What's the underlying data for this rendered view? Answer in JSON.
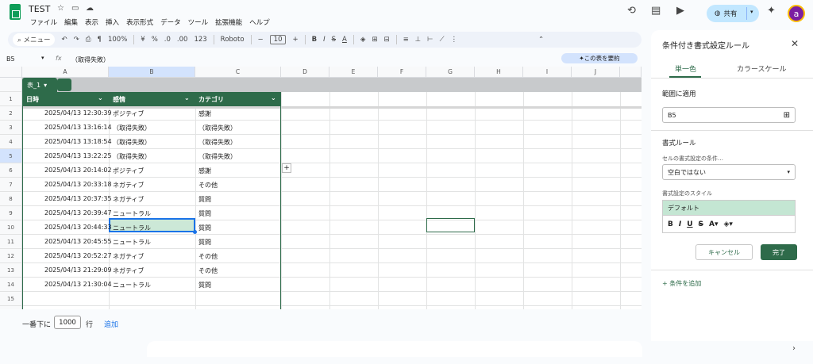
{
  "app": {
    "doc_title": "TEST",
    "menu": [
      "ファイル",
      "編集",
      "表示",
      "挿入",
      "表示形式",
      "データ",
      "ツール",
      "拡張機能",
      "ヘルプ"
    ],
    "share_label": "共有",
    "avatar_letter": "a"
  },
  "toolbar": {
    "search_label": "メニュー",
    "zoom": "100%",
    "currency": "¥",
    "percent": "%",
    "dec_less": ".0",
    "dec_more": ".00",
    "number_format": "123",
    "font": "Roboto",
    "font_size": "10"
  },
  "formula_bar": {
    "cell_ref": "B5",
    "fx": "fx",
    "value": "（取得失敗）",
    "summarize_label": "この表を要約"
  },
  "grid": {
    "columns": [
      "A",
      "B",
      "C",
      "D",
      "E",
      "F",
      "G",
      "H",
      "I",
      "J"
    ],
    "rows": [
      "1",
      "2",
      "3",
      "4",
      "5",
      "6",
      "7",
      "8",
      "9",
      "10",
      "11",
      "12",
      "13",
      "14",
      "15"
    ],
    "table_name": "表_1",
    "table_headers": [
      "日時",
      "感情",
      "カテゴリ"
    ],
    "table_rows": [
      [
        "2025/04/13 12:30:39",
        "ポジティブ",
        "感謝"
      ],
      [
        "2025/04/13 13:16:14",
        "（取得失敗）",
        "（取得失敗）"
      ],
      [
        "2025/04/13 13:18:54",
        "（取得失敗）",
        "（取得失敗）"
      ],
      [
        "2025/04/13 13:22:25",
        "（取得失敗）",
        "（取得失敗）"
      ],
      [
        "2025/04/13 20:14:02",
        "ポジティブ",
        "感謝"
      ],
      [
        "2025/04/13 20:33:18",
        "ネガティブ",
        "その他"
      ],
      [
        "2025/04/13 20:37:35",
        "ネガティブ",
        "質問"
      ],
      [
        "2025/04/13 20:39:47",
        "ニュートラル",
        "質問"
      ],
      [
        "2025/04/13 20:44:33",
        "ニュートラル",
        "質問"
      ],
      [
        "2025/04/13 20:45:55",
        "ニュートラル",
        "質問"
      ],
      [
        "2025/04/13 20:52:27",
        "ネガティブ",
        "その他"
      ],
      [
        "2025/04/13 21:29:09",
        "ネガティブ",
        "その他"
      ],
      [
        "2025/04/13 21:30:04",
        "ニュートラル",
        "質問"
      ]
    ]
  },
  "footer": {
    "prefix": "一番下に",
    "count": "1000",
    "unit": "行",
    "add_label": "追加"
  },
  "panel": {
    "title": "条件付き書式設定ルール",
    "tab_single": "単一色",
    "tab_scale": "カラースケール",
    "range_label": "範囲に適用",
    "range_value": "B5",
    "rules_label": "書式ルール",
    "condition_label": "セルの書式設定の条件…",
    "condition_value": "空白ではない",
    "style_label": "書式設定のスタイル",
    "style_default": "デフォルト",
    "cancel_label": "キャンセル",
    "done_label": "完了",
    "add_rule_label": "条件を追加"
  },
  "colors": {
    "table_green": "#2e6b4a",
    "selection_blue": "#1a73e8",
    "style_preview": "#c4e6d3"
  }
}
